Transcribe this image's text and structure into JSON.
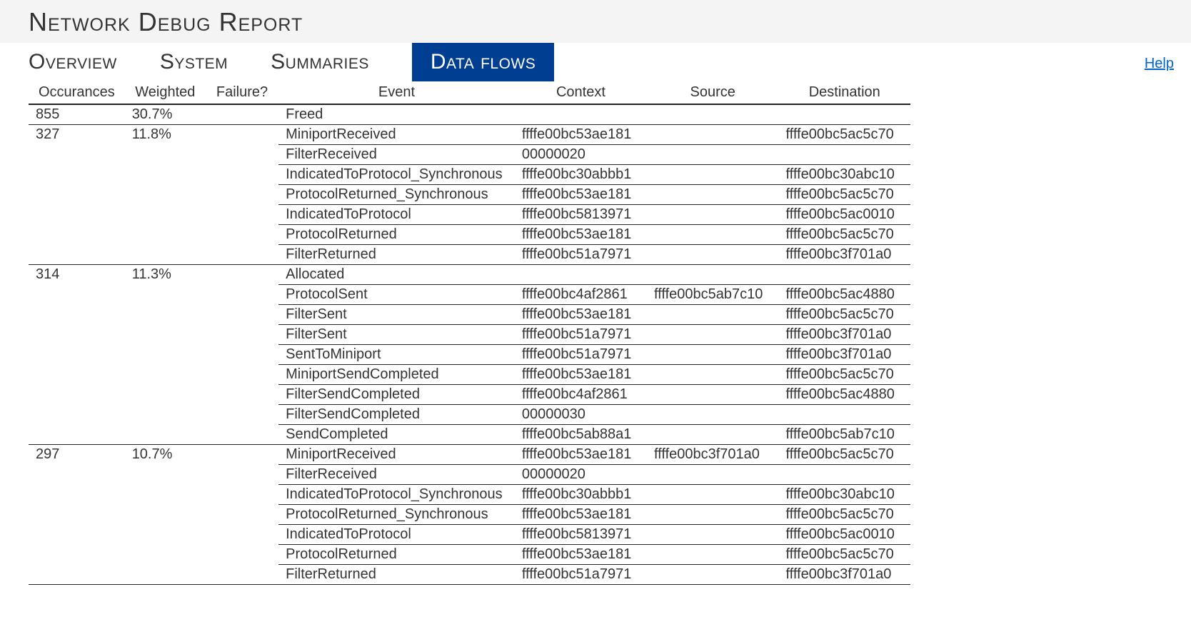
{
  "title": "Network Debug Report",
  "help_label": "Help",
  "tabs": [
    {
      "label": "Overview",
      "active": false
    },
    {
      "label": "System",
      "active": false
    },
    {
      "label": "Summaries",
      "active": false
    },
    {
      "label": "Data flows",
      "active": true
    }
  ],
  "columns": {
    "occurances": "Occurances",
    "weighted": "Weighted",
    "failure": "Failure?",
    "event": "Event",
    "context": "Context",
    "source": "Source",
    "destination": "Destination"
  },
  "groups": [
    {
      "occurances": "855",
      "weighted": "30.7%",
      "failure": "",
      "rows": [
        {
          "event": "Freed",
          "context": "",
          "source": "",
          "destination": ""
        }
      ]
    },
    {
      "occurances": "327",
      "weighted": "11.8%",
      "failure": "",
      "rows": [
        {
          "event": "MiniportReceived",
          "context": "ffffe00bc53ae181",
          "source": "",
          "destination": "ffffe00bc5ac5c70"
        },
        {
          "event": "FilterReceived",
          "context": "00000020",
          "source": "",
          "destination": ""
        },
        {
          "event": "IndicatedToProtocol_Synchronous",
          "context": "ffffe00bc30abbb1",
          "source": "",
          "destination": "ffffe00bc30abc10"
        },
        {
          "event": "ProtocolReturned_Synchronous",
          "context": "ffffe00bc53ae181",
          "source": "",
          "destination": "ffffe00bc5ac5c70"
        },
        {
          "event": "IndicatedToProtocol",
          "context": "ffffe00bc5813971",
          "source": "",
          "destination": "ffffe00bc5ac0010"
        },
        {
          "event": "ProtocolReturned",
          "context": "ffffe00bc53ae181",
          "source": "",
          "destination": "ffffe00bc5ac5c70"
        },
        {
          "event": "FilterReturned",
          "context": "ffffe00bc51a7971",
          "source": "",
          "destination": "ffffe00bc3f701a0"
        }
      ]
    },
    {
      "occurances": "314",
      "weighted": "11.3%",
      "failure": "",
      "rows": [
        {
          "event": "Allocated",
          "context": "",
          "source": "",
          "destination": ""
        },
        {
          "event": "ProtocolSent",
          "context": "ffffe00bc4af2861",
          "source": "ffffe00bc5ab7c10",
          "destination": "ffffe00bc5ac4880"
        },
        {
          "event": "FilterSent",
          "context": "ffffe00bc53ae181",
          "source": "",
          "destination": "ffffe00bc5ac5c70"
        },
        {
          "event": "FilterSent",
          "context": "ffffe00bc51a7971",
          "source": "",
          "destination": "ffffe00bc3f701a0"
        },
        {
          "event": "SentToMiniport",
          "context": "ffffe00bc51a7971",
          "source": "",
          "destination": "ffffe00bc3f701a0"
        },
        {
          "event": "MiniportSendCompleted",
          "context": "ffffe00bc53ae181",
          "source": "",
          "destination": "ffffe00bc5ac5c70"
        },
        {
          "event": "FilterSendCompleted",
          "context": "ffffe00bc4af2861",
          "source": "",
          "destination": "ffffe00bc5ac4880"
        },
        {
          "event": "FilterSendCompleted",
          "context": "00000030",
          "source": "",
          "destination": ""
        },
        {
          "event": "SendCompleted",
          "context": "ffffe00bc5ab88a1",
          "source": "",
          "destination": "ffffe00bc5ab7c10"
        }
      ]
    },
    {
      "occurances": "297",
      "weighted": "10.7%",
      "failure": "",
      "rows": [
        {
          "event": "MiniportReceived",
          "context": "ffffe00bc53ae181",
          "source": "ffffe00bc3f701a0",
          "destination": "ffffe00bc5ac5c70"
        },
        {
          "event": "FilterReceived",
          "context": "00000020",
          "source": "",
          "destination": ""
        },
        {
          "event": "IndicatedToProtocol_Synchronous",
          "context": "ffffe00bc30abbb1",
          "source": "",
          "destination": "ffffe00bc30abc10"
        },
        {
          "event": "ProtocolReturned_Synchronous",
          "context": "ffffe00bc53ae181",
          "source": "",
          "destination": "ffffe00bc5ac5c70"
        },
        {
          "event": "IndicatedToProtocol",
          "context": "ffffe00bc5813971",
          "source": "",
          "destination": "ffffe00bc5ac0010"
        },
        {
          "event": "ProtocolReturned",
          "context": "ffffe00bc53ae181",
          "source": "",
          "destination": "ffffe00bc5ac5c70"
        },
        {
          "event": "FilterReturned",
          "context": "ffffe00bc51a7971",
          "source": "",
          "destination": "ffffe00bc3f701a0"
        }
      ]
    }
  ]
}
